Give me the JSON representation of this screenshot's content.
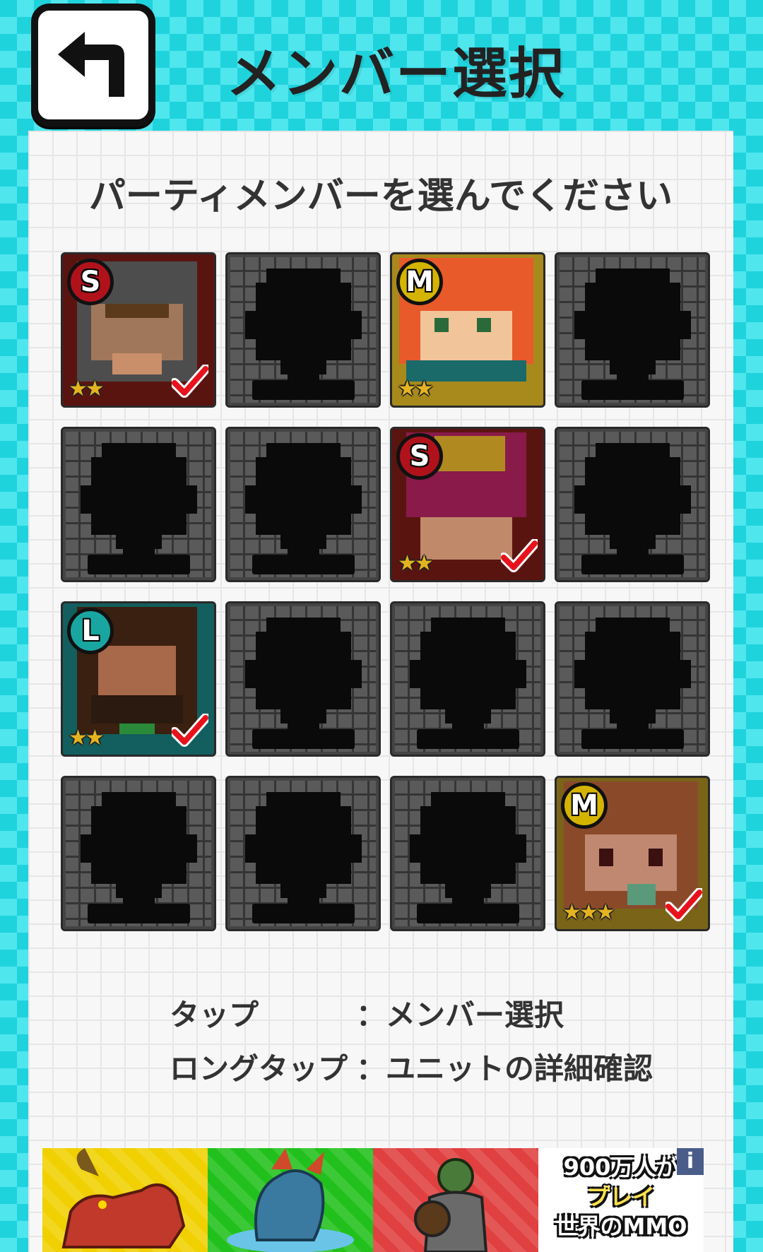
{
  "header": {
    "back_icon": "back-arrow-icon",
    "title": "メンバー選択"
  },
  "panel": {
    "instruction": "パーティメンバーを選んでください"
  },
  "members": [
    {
      "filled": true,
      "rank": "S",
      "rank_color": "#b0121c",
      "stars": "★★",
      "selected": true,
      "frame_color": "#5a1410",
      "portrait": "gray-hood-hero"
    },
    {
      "filled": false
    },
    {
      "filled": true,
      "rank": "M",
      "rank_color": "#d4b400",
      "stars": "★★",
      "selected": false,
      "frame_color": "#a88a1c",
      "portrait": "orange-hair-girl"
    },
    {
      "filled": false
    },
    {
      "filled": false
    },
    {
      "filled": false
    },
    {
      "filled": true,
      "rank": "S",
      "rank_color": "#b0121c",
      "stars": "★★",
      "selected": true,
      "frame_color": "#5a1410",
      "portrait": "crimson-turban-warrior"
    },
    {
      "filled": false
    },
    {
      "filled": true,
      "rank": "L",
      "rank_color": "#1aa6a0",
      "stars": "★★",
      "selected": true,
      "frame_color": "#135e5e",
      "portrait": "bearded-man"
    },
    {
      "filled": false
    },
    {
      "filled": false
    },
    {
      "filled": false
    },
    {
      "filled": false
    },
    {
      "filled": false
    },
    {
      "filled": false
    },
    {
      "filled": true,
      "rank": "M",
      "rank_color": "#d4b400",
      "stars": "★★★",
      "selected": true,
      "frame_color": "#7a6418",
      "portrait": "brown-hair-girl"
    }
  ],
  "help": [
    {
      "key": "タップ",
      "desc": "：メンバー選択"
    },
    {
      "key": "ロングタップ",
      "desc": "：ユニットの詳細確認"
    }
  ],
  "ad": {
    "info_label": "i",
    "text_line1": "900万人が",
    "text_line2": "プレイ",
    "text_line3": "世界のMMO",
    "tiles": [
      {
        "bg": "#f0d000",
        "icon": "red-beast-icon"
      },
      {
        "bg": "#22c01c",
        "icon": "blue-dragon-icon"
      },
      {
        "bg": "#e04040",
        "icon": "orc-warrior-icon"
      }
    ]
  }
}
